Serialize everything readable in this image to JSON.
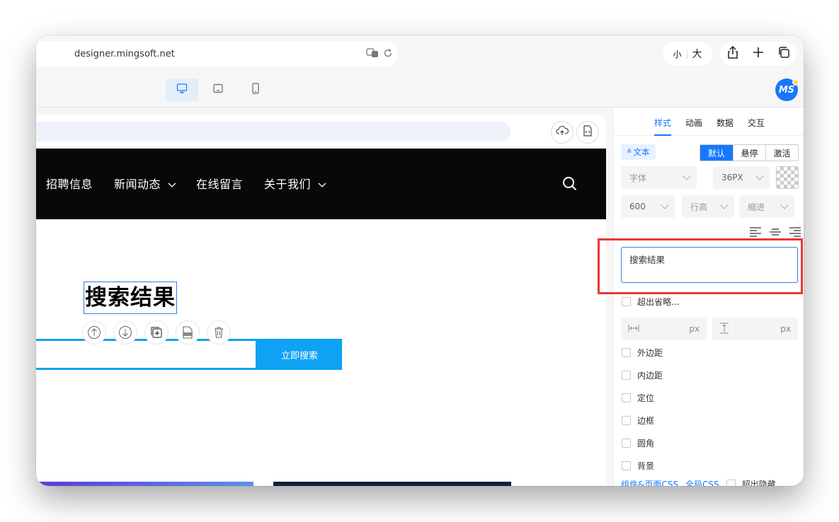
{
  "browser": {
    "url": "designer.mingsoft.net",
    "font_size_small": "小",
    "font_size_large": "大"
  },
  "site_nav": {
    "items": [
      "招聘信息",
      "新闻动态",
      "在线留言",
      "关于我们"
    ]
  },
  "canvas": {
    "selected_title": "搜索结果",
    "search_button": "立即搜索"
  },
  "panel": {
    "tabs": [
      "样式",
      "动画",
      "数据",
      "交互"
    ],
    "active_tab": "样式",
    "text_tag": "文本",
    "states": [
      "默认",
      "悬停",
      "激活"
    ],
    "font_family_placeholder": "字体",
    "font_size_value": "36PX",
    "font_weight_value": "600",
    "line_height_placeholder": "行高",
    "indent_placeholder": "缩进",
    "text_value": "搜索结果",
    "overflow_ellipsis": "超出省略...",
    "unit_px": "px",
    "options": [
      "外边距",
      "内边距",
      "定位",
      "边框",
      "圆角",
      "背景"
    ],
    "footer_links": [
      "组件&页面CSS",
      "全局CSS"
    ],
    "footer_check": "超出隐藏"
  },
  "colors": {
    "accent": "#1677ff",
    "nav_bg": "#07080a",
    "search_button": "#0fa2f5",
    "highlight": "#e53935"
  }
}
